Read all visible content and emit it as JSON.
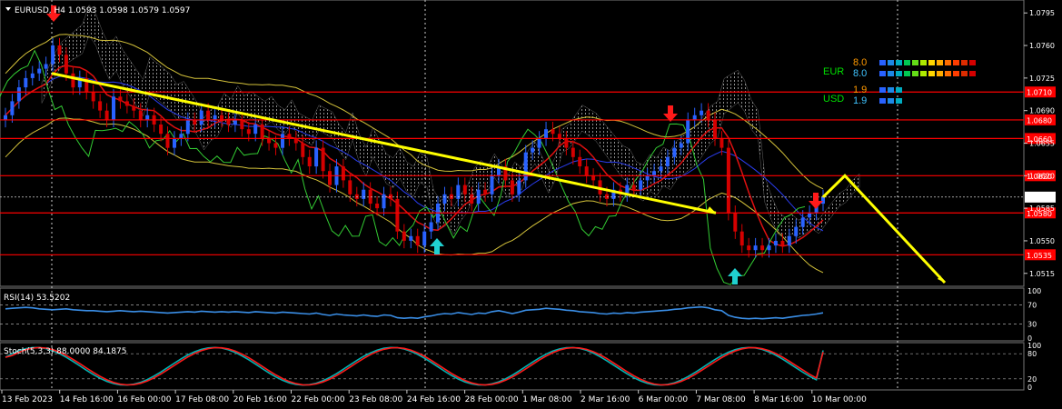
{
  "colors": {
    "background": "#000000",
    "bull": "#2962ff",
    "bear": "#d50000",
    "level": "#ff0000",
    "trend": "#ffff00",
    "rsi": "#3a8ee6",
    "stoch_main": "#00b3b3",
    "stoch_signal": "#ff1a1a",
    "eur": "#00e000",
    "usd": "#00e000",
    "value_orange": "#ff9900",
    "value_cyan": "#40c4ff"
  },
  "chart_data": [
    {
      "type": "candlestick",
      "title": "EURUSD, H4 1.0593 1.0598 1.0579 1.0597",
      "symbol": "EURUSD",
      "timeframe": "H4",
      "ohlc_last": [
        1.0593,
        1.0598,
        1.0579,
        1.0597
      ],
      "ylim": [
        1.0505,
        1.0805
      ],
      "y_ticks": [
        1.0795,
        1.076,
        1.0725,
        1.069,
        1.0655,
        1.062,
        1.0585,
        1.055,
        1.0515
      ],
      "x_labels": [
        "13 Feb 2023",
        "14 Feb 16:00",
        "16 Feb 00:00",
        "17 Feb 08:00",
        "20 Feb 16:00",
        "22 Feb 00:00",
        "23 Feb 08:00",
        "24 Feb 16:00",
        "28 Feb 00:00",
        "1 Mar 08:00",
        "2 Mar 16:00",
        "6 Mar 00:00",
        "7 Mar 08:00",
        "8 Mar 16:00",
        "10 Mar 00:00"
      ],
      "levels": [
        1.071,
        1.068,
        1.066,
        1.062,
        1.0597,
        1.058,
        1.0535
      ],
      "level_labels": [
        "1.0710",
        "1.0680",
        "1.0660",
        "1.0620",
        "1.0597",
        "1.0580",
        "1.0535"
      ],
      "close": [
        1.0685,
        1.07,
        1.0715,
        1.0725,
        1.073,
        1.0735,
        1.074,
        1.076,
        1.075,
        1.073,
        1.0715,
        1.0725,
        1.071,
        1.07,
        1.069,
        1.068,
        1.0705,
        1.07,
        1.0695,
        1.069,
        1.068,
        1.0685,
        1.0675,
        1.0665,
        1.065,
        1.066,
        1.0665,
        1.068,
        1.0675,
        1.069,
        1.068,
        1.0685,
        1.068,
        1.0675,
        1.068,
        1.067,
        1.0665,
        1.0675,
        1.066,
        1.0655,
        1.065,
        1.0665,
        1.066,
        1.0655,
        1.064,
        1.063,
        1.065,
        1.0625,
        1.061,
        1.063,
        1.0615,
        1.06,
        1.0595,
        1.0605,
        1.059,
        1.0585,
        1.06,
        1.0595,
        1.056,
        1.055,
        1.0555,
        1.0545,
        1.056,
        1.057,
        1.059,
        1.06,
        1.0595,
        1.061,
        1.06,
        1.059,
        1.0605,
        1.06,
        1.062,
        1.063,
        1.0615,
        1.06,
        1.0615,
        1.0645,
        1.065,
        1.066,
        1.067,
        1.0665,
        1.066,
        1.065,
        1.064,
        1.063,
        1.062,
        1.0615,
        1.06,
        1.0595,
        1.0605,
        1.06,
        1.061,
        1.0605,
        1.0615,
        1.062,
        1.0625,
        1.063,
        1.064,
        1.065,
        1.0655,
        1.068,
        1.0685,
        1.069,
        1.068,
        1.066,
        1.065,
        1.058,
        1.056,
        1.0545,
        1.054,
        1.0545,
        1.054,
        1.0545,
        1.055,
        1.0545,
        1.0555,
        1.0565,
        1.0575,
        1.058,
        1.059,
        1.0597
      ],
      "rsi": {
        "label": "RSI(14) 53.5202",
        "value": 53.5202,
        "ylim": [
          0,
          100
        ],
        "ticks": [
          100,
          70,
          30,
          0
        ],
        "series": [
          62,
          63,
          64,
          65,
          64,
          62,
          61,
          60,
          61,
          62,
          60,
          59,
          58,
          58,
          57,
          56,
          57,
          58,
          57,
          56,
          57,
          56,
          55,
          54,
          53,
          54,
          55,
          56,
          55,
          57,
          56,
          55,
          56,
          55,
          56,
          55,
          54,
          56,
          55,
          54,
          53,
          55,
          54,
          53,
          52,
          51,
          53,
          50,
          48,
          51,
          49,
          48,
          47,
          49,
          47,
          46,
          49,
          48,
          43,
          42,
          43,
          42,
          45,
          47,
          50,
          52,
          51,
          54,
          52,
          50,
          53,
          52,
          56,
          58,
          55,
          52,
          55,
          59,
          60,
          61,
          63,
          62,
          61,
          59,
          58,
          56,
          55,
          54,
          52,
          51,
          53,
          52,
          54,
          53,
          55,
          56,
          57,
          58,
          59,
          61,
          62,
          64,
          65,
          66,
          64,
          60,
          58,
          48,
          44,
          42,
          41,
          42,
          41,
          42,
          43,
          42,
          44,
          46,
          48,
          49,
          51,
          53.52
        ]
      },
      "stochastic": {
        "label": "Stoch(5,3,3) 88.0000 84.1875",
        "main": 88.0,
        "signal": 84.1875,
        "ylim": [
          0,
          100
        ],
        "ticks": [
          100,
          80,
          20,
          0
        ]
      }
    }
  ],
  "signals": {
    "down_arrows": [
      "sell-arrow-1",
      "sell-arrow-2",
      "sell-arrow-3"
    ],
    "up_arrows": [
      "buy-arrow-1",
      "buy-arrow-2"
    ]
  },
  "strength": {
    "eur_label": "EUR",
    "usd_label": "USD",
    "eur_top": "8.0",
    "eur_bottom": "8.0",
    "usd_top": "1.9",
    "usd_bottom": "1.9"
  },
  "icons": {
    "menu": "triangle-down-icon"
  }
}
